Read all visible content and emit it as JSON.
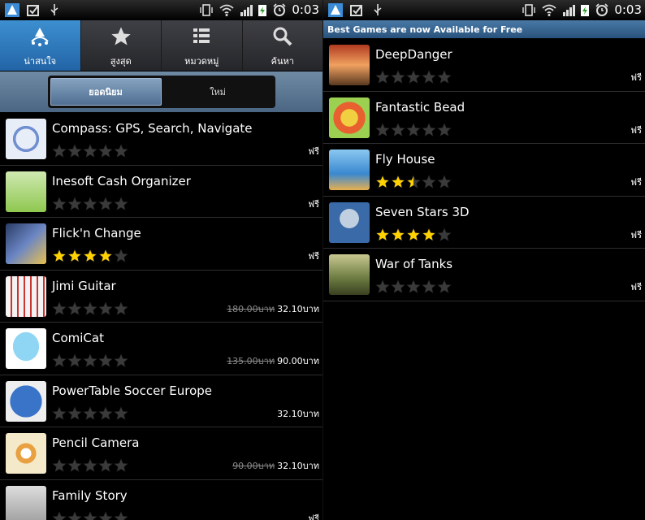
{
  "status": {
    "time": "0:03"
  },
  "left": {
    "tabs": [
      {
        "label": "น่าสนใจ",
        "icon": "featured-icon",
        "active": true
      },
      {
        "label": "สูงสุด",
        "icon": "star-icon",
        "active": false
      },
      {
        "label": "หมวดหมู่",
        "icon": "category-list-icon",
        "active": false
      },
      {
        "label": "ค้นหา",
        "icon": "search-icon",
        "active": false
      }
    ],
    "segments": [
      {
        "label": "ยอดนิยม",
        "selected": true
      },
      {
        "label": "ใหม่",
        "selected": false
      }
    ],
    "apps": [
      {
        "name": "Compass: GPS, Search, Navigate",
        "rating": 0,
        "price_old": "",
        "price": "ฟรี",
        "icon": "compass-app-icon"
      },
      {
        "name": "Inesoft Cash Organizer",
        "rating": 0,
        "price_old": "",
        "price": "ฟรี",
        "icon": "cash-organizer-app-icon"
      },
      {
        "name": "Flick'n Change",
        "rating": 4,
        "price_old": "",
        "price": "ฟรี",
        "icon": "flick-change-app-icon"
      },
      {
        "name": "Jimi Guitar",
        "rating": 0,
        "price_old": "180.00บาท",
        "price": "32.10บาท",
        "icon": "guitar-app-icon"
      },
      {
        "name": "ComiCat",
        "rating": 0,
        "price_old": "135.00บาท",
        "price": "90.00บาท",
        "icon": "comicat-app-icon"
      },
      {
        "name": "PowerTable Soccer Europe",
        "rating": 0,
        "price_old": "",
        "price": "32.10บาท",
        "icon": "europe-app-icon"
      },
      {
        "name": "Pencil Camera",
        "rating": 0,
        "price_old": "90.00บาท",
        "price": "32.10บาท",
        "icon": "camera-app-icon"
      },
      {
        "name": "Family Story",
        "rating": 0,
        "price_old": "",
        "price": "ฟรี",
        "icon": "home-app-icon"
      }
    ]
  },
  "right": {
    "banner": "Best Games are now Available for Free",
    "apps": [
      {
        "name": "DeepDanger",
        "rating": 0,
        "price": "ฟรี",
        "icon": "deepdanger-app-icon"
      },
      {
        "name": "Fantastic Bead",
        "rating": 0,
        "price": "ฟรี",
        "icon": "bead-app-icon"
      },
      {
        "name": "Fly House",
        "rating": 2.5,
        "price": "ฟรี",
        "icon": "flyhouse-app-icon"
      },
      {
        "name": "Seven Stars 3D",
        "rating": 4,
        "price": "ฟรี",
        "icon": "sevenstars-app-icon"
      },
      {
        "name": "War of Tanks",
        "rating": 0,
        "price": "ฟรี",
        "icon": "tanks-app-icon"
      }
    ]
  },
  "colors": {
    "active_tab": "#2f7cc0",
    "star_filled": "#ffd200",
    "star_empty": "#3a3a3a"
  }
}
